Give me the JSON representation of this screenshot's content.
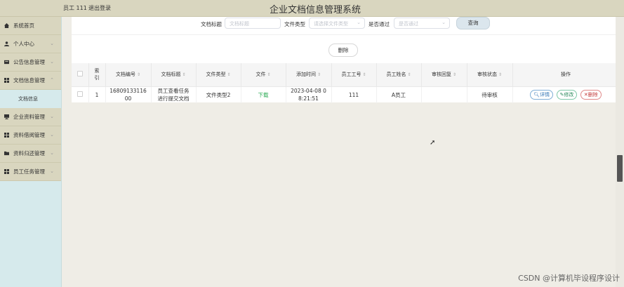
{
  "header": {
    "user": "员工 111",
    "logout": "退出登录",
    "app_title": "企业文档信息管理系统"
  },
  "sidebar": {
    "items": [
      {
        "label": "系统首页",
        "icon": "home-icon",
        "chev": ""
      },
      {
        "label": "个人中心",
        "icon": "user-icon",
        "chev": "⌄"
      },
      {
        "label": "公告信息管理",
        "icon": "notice-icon",
        "chev": "⌄"
      },
      {
        "label": "文档信息管理",
        "icon": "grid-icon",
        "chev": "⌃"
      },
      {
        "label": "文档信息",
        "sub": true
      },
      {
        "label": "企业资料管理",
        "icon": "monitor-icon",
        "chev": "⌄"
      },
      {
        "label": "资料借阅管理",
        "icon": "grid-icon",
        "chev": "⌄"
      },
      {
        "label": "资料归还管理",
        "icon": "folder-icon",
        "chev": "⌄"
      },
      {
        "label": "员工任务管理",
        "icon": "grid-icon",
        "chev": "⌄"
      }
    ]
  },
  "search": {
    "title_label": "文档标题",
    "title_placeholder": "文档标题",
    "type_label": "文件类型",
    "type_placeholder": "请选择文件类型",
    "pass_label": "是否通过",
    "pass_placeholder": "是否通过",
    "query_button": "查询"
  },
  "toolbar": {
    "delete_button": "删除"
  },
  "table": {
    "columns": [
      "索引",
      "文档编号",
      "文档标题",
      "文件类型",
      "文件",
      "添加时间",
      "员工工号",
      "员工姓名",
      "审核回复",
      "审核状态",
      "操作"
    ],
    "index_header_line1": "索",
    "index_header_line2": "引",
    "rows": [
      {
        "index": "1",
        "doc_no": "1680913311600",
        "title_line1": "员工查看任务",
        "title_line2": "进行提交文档",
        "file_type": "文件类型2",
        "file": "下载",
        "added_line1": "2023-04-08 0",
        "added_line2": "8:21:51",
        "staff_no": "111",
        "staff_name": "A员工",
        "reply": "",
        "status": "待审核",
        "op_detail": "详情",
        "op_edit": "修改",
        "op_delete": "删除"
      }
    ]
  },
  "watermark": "CSDN @计算机毕设程序设计"
}
